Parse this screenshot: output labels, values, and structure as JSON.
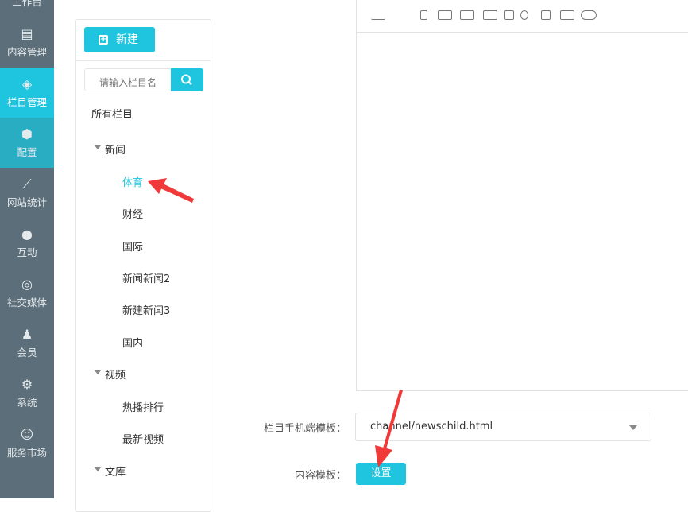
{
  "sidebar": {
    "items": [
      {
        "label": "工作台",
        "icon": "desktop-icon"
      },
      {
        "label": "内容管理",
        "icon": "document-icon"
      },
      {
        "label": "栏目管理",
        "icon": "layers-icon"
      },
      {
        "label": "配置",
        "icon": "cube-icon"
      },
      {
        "label": "网站统计",
        "icon": "line-chart-icon"
      },
      {
        "label": "互动",
        "icon": "chat-icon"
      },
      {
        "label": "社交媒体",
        "icon": "social-icon"
      },
      {
        "label": "会员",
        "icon": "member-icon"
      },
      {
        "label": "系统",
        "icon": "gear-icon"
      },
      {
        "label": "服务市场",
        "icon": "service-icon"
      }
    ],
    "active": "栏目管理"
  },
  "panel": {
    "new_label": "新建",
    "search_placeholder": "请输入栏目名",
    "all_label": "所有栏目",
    "tree": [
      "新闻",
      "体育",
      "财经",
      "国际",
      "新闻新闻2",
      "新建新闻3",
      "国内",
      "视频",
      "热播排行",
      "最新视频",
      "文库"
    ]
  },
  "form": {
    "mobile_template_label": "栏目手机端模板：",
    "mobile_template_value": "channel/newschild.html",
    "content_template_label": "内容模板：",
    "set_label": "设置"
  },
  "colors": {
    "accent": "#1fc5de",
    "sidebar": "#5b6e79",
    "arrow": "#f03a3a"
  }
}
